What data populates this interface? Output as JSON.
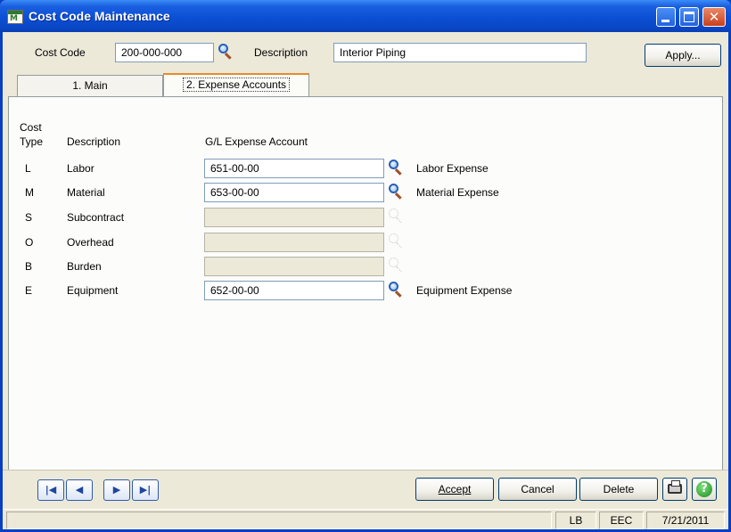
{
  "window": {
    "title": "Cost Code Maintenance",
    "app_icon": "mas-app-icon"
  },
  "header": {
    "cost_code_label": "Cost Code",
    "cost_code_value": "200-000-000",
    "description_label": "Description",
    "description_value": "Interior Piping",
    "apply_label": "Apply..."
  },
  "tabs": [
    {
      "label": "1. Main",
      "active": false
    },
    {
      "label": "2. Expense Accounts",
      "active": true
    }
  ],
  "grid": {
    "col_cost_type_line1": "Cost",
    "col_cost_type_line2": "Type",
    "col_description": "Description",
    "col_gl_account": "G/L Expense Account",
    "rows": [
      {
        "type": "L",
        "description": "Labor",
        "account": "651-00-00",
        "account_desc": "Labor Expense",
        "enabled": true
      },
      {
        "type": "M",
        "description": "Material",
        "account": "653-00-00",
        "account_desc": "Material Expense",
        "enabled": true
      },
      {
        "type": "S",
        "description": "Subcontract",
        "account": "",
        "account_desc": "",
        "enabled": false
      },
      {
        "type": "O",
        "description": "Overhead",
        "account": "",
        "account_desc": "",
        "enabled": false
      },
      {
        "type": "B",
        "description": "Burden",
        "account": "",
        "account_desc": "",
        "enabled": false
      },
      {
        "type": "E",
        "description": "Equipment",
        "account": "652-00-00",
        "account_desc": "Equipment Expense",
        "enabled": true
      }
    ]
  },
  "footer": {
    "accept_label": "Accept",
    "cancel_label": "Cancel",
    "delete_label": "Delete"
  },
  "status": {
    "main": "",
    "user": "LB",
    "company": "EEC",
    "date": "7/21/2011"
  },
  "colors": {
    "titlebar": "#0b4fd4",
    "client_bg": "#ece9d8",
    "tab_accent": "#e68b2c"
  }
}
